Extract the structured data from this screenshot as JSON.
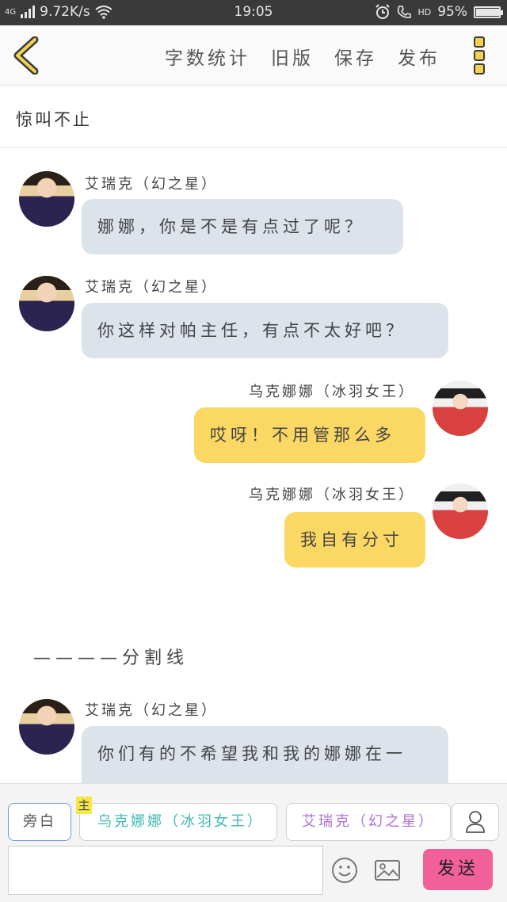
{
  "status_bar": {
    "network": "4G",
    "speed": "9.72K/s",
    "time": "19:05",
    "hd": "HD",
    "battery": "95%",
    "battery_level": 0.95
  },
  "toolbar": {
    "back_icon": "chevron-left-icon",
    "actions": [
      "字数统计",
      "旧版",
      "保存",
      "发布"
    ],
    "menu_icon": "more-vertical-icon"
  },
  "title": "惊叫不止",
  "messages": [
    {
      "side": "left",
      "speaker": "艾瑞克（幻之星）",
      "text": "娜娜，你是不是有点过了呢？"
    },
    {
      "side": "left",
      "speaker": "艾瑞克（幻之星）",
      "text": "你这样对帕主任，有点不太好吧？"
    },
    {
      "side": "right",
      "speaker": "乌克娜娜（冰羽女王）",
      "text": "哎呀！不用管那么多"
    },
    {
      "side": "right",
      "speaker": "乌克娜娜（冰羽女王）",
      "text": "我自有分寸"
    },
    {
      "divider": "————分割线"
    },
    {
      "side": "left",
      "speaker": "艾瑞克（幻之星）",
      "text": "你们有的不希望我和我的娜娜在一起，哼，我好生气，好你们啊"
    }
  ],
  "composer": {
    "narration_label": "旁白",
    "main_tag": "主",
    "role_una": "乌克娜娜（冰羽女王）",
    "role_eric": "艾瑞克（幻之星）",
    "person_icon": "person-icon",
    "input_placeholder": "",
    "emoji_icon": "smiley-icon",
    "image_icon": "image-icon",
    "send_label": "发送"
  },
  "colors": {
    "left_bubble": "#dde3ea",
    "right_bubble": "#fbd863",
    "send_button": "#f2609a",
    "role_una": "#3fb9b0",
    "role_eric": "#b070d8"
  }
}
